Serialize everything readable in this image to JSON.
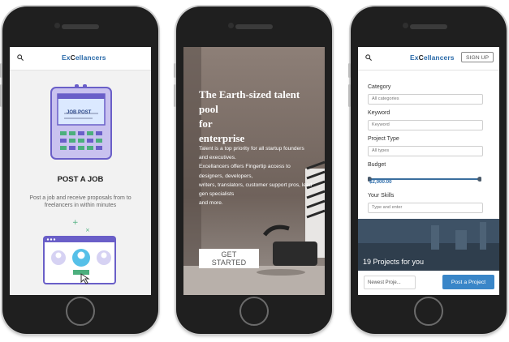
{
  "logo": {
    "prefix": "Ex",
    "mark": "C",
    "suffix": "ellancers"
  },
  "phone1": {
    "card_label": "JOB POST",
    "title": "POST A JOB",
    "description": "Post a job and receive proposals from to freelancers in within minutes"
  },
  "phone2": {
    "headline_line1": "The Earth-sized talent pool",
    "headline_line2": "for",
    "headline_line3": "enterprise",
    "body_1": "Talent is a top priority for all startup founders and executives.",
    "body_2": "Excellancers offers Fingertip access to designers, developers,",
    "body_3": "writers, translators, customer support pros, lead gen specialists",
    "body_4": "and more.",
    "cta": "GET STARTED"
  },
  "phone3": {
    "signup": "SIGN UP",
    "fields": {
      "category": {
        "label": "Category",
        "value": "All categories"
      },
      "keyword": {
        "label": "Keyword",
        "placeholder": "Keyword"
      },
      "project_type": {
        "label": "Project Type",
        "value": "All types"
      },
      "budget": {
        "label": "Budget",
        "value": "$2,000.00",
        "fraction": 1.0
      },
      "skills": {
        "label": "Your Skills",
        "placeholder": "Type and enter"
      }
    },
    "projects_count": "19 Projects for you",
    "sort": "Newest Proje...",
    "post_button": "Post a Project"
  },
  "colors": {
    "brand_blue": "#2a6aa9",
    "button_blue": "#3a86c8",
    "illustration_purple": "#6a5fc8"
  }
}
